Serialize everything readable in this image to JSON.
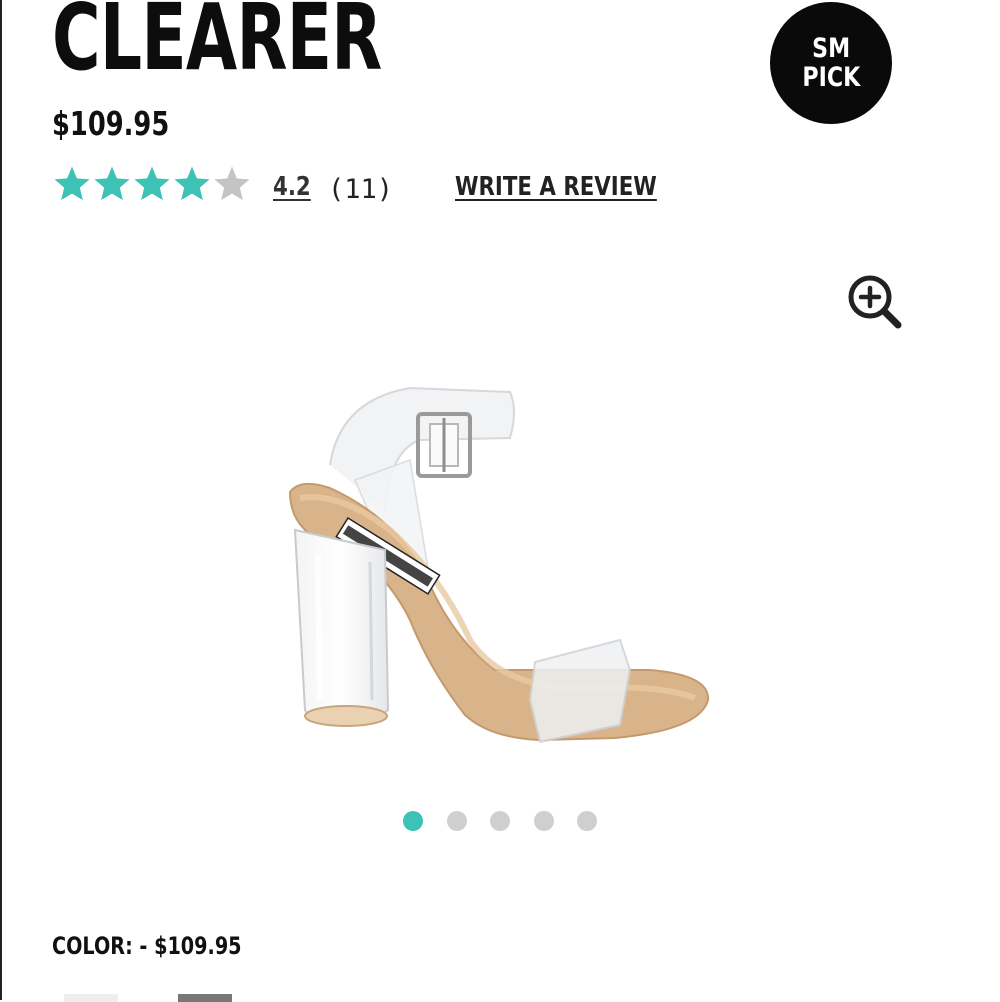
{
  "product": {
    "title": "CLEARER",
    "price": "$109.95",
    "badge_line1": "SM",
    "badge_line2": "PICK"
  },
  "rating": {
    "value": "4.2",
    "count": "(11)",
    "stars_filled": 4,
    "stars_total": 5,
    "star_color": "#3fc2b6",
    "empty_star_color": "#c4c4c4"
  },
  "actions": {
    "write_review": "WRITE A REVIEW"
  },
  "carousel": {
    "total": 5,
    "active_index": 0,
    "active_color": "#3fc2b6",
    "inactive_color": "#cfcfcf"
  },
  "color": {
    "line": "COLOR: - $109.95"
  },
  "icons": {
    "zoom": "zoom-in-icon"
  }
}
